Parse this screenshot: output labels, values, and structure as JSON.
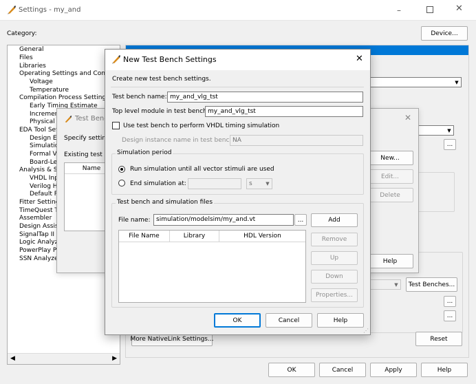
{
  "main_window": {
    "title": "Settings - my_and",
    "category_label": "Category:",
    "device_button": "Device...",
    "tree": [
      "General",
      "Files",
      "Libraries",
      "Operating Settings and Conditi",
      "Voltage",
      "Temperature",
      "Compilation Process Settings",
      "Early Timing Estimate",
      "Increment",
      "Physical S",
      "EDA Tool Set",
      "Design En",
      "Simulatio",
      "Formal Ve",
      "Board-Lev",
      "Analysis & Sy",
      "VHDL Inpu",
      "Verilog HI",
      "Default Pa",
      "Fitter Setting",
      "TimeQuest T",
      "Assembler",
      "Design Assist",
      "SignalTap II L",
      "Logic Analyze",
      "PowerPlay Po",
      "SSN Analyzer"
    ],
    "more_nativelink_button": "More NativeLink Settings...",
    "reset_button": "Reset",
    "test_benches_button": "Test Benches...",
    "ellipsis": "...",
    "ok_button": "OK",
    "cancel_button": "Cancel",
    "apply_button": "Apply",
    "help_button": "Help"
  },
  "test_bench_dialog": {
    "title": "Test Bench",
    "specify_text": "Specify setting",
    "existing_text": "Existing test be",
    "name_header": "Name",
    "new_button": "New...",
    "edit_button": "Edit...",
    "delete_button": "Delete",
    "help_button": "Help"
  },
  "new_dialog": {
    "title": "New Test Bench Settings",
    "intro": "Create new test bench settings.",
    "tb_name_label": "Test bench name:",
    "tb_name_value": "my_and_vlg_tst",
    "top_module_label": "Top level module in test bench:",
    "top_module_value": "my_and_vlg_tst",
    "vhdl_checkbox_label": "Use test bench to perform VHDL timing simulation",
    "instance_label": "Design instance name in test bench:",
    "instance_value": "NA",
    "sim_period_title": "Simulation period",
    "run_until_label": "Run simulation until all vector stimuli are used",
    "end_sim_label": "End simulation at:",
    "end_unit": "s",
    "files_title": "Test bench and simulation files",
    "file_name_label": "File name:",
    "file_name_value": "simulation/modelsim/my_and.vt",
    "browse_button": "...",
    "columns": [
      "File Name",
      "Library",
      "HDL Version"
    ],
    "add_button": "Add",
    "remove_button": "Remove",
    "up_button": "Up",
    "down_button": "Down",
    "properties_button": "Properties...",
    "ok_button": "OK",
    "cancel_button": "Cancel",
    "help_button": "Help"
  }
}
